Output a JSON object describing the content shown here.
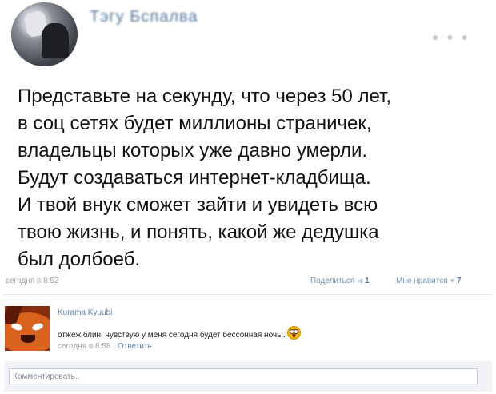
{
  "post": {
    "author": "Тэгу Бспалва",
    "more_icon": "more-horizontal-icon",
    "text_lines": [
      "Представьте на секунду, что через 50 лет,",
      "в соц сетях будет миллионы страничек,",
      "владельцы которых уже давно умерли.",
      "Будут создаваться интернет-кладбища.",
      "И твой внук сможет зайти и увидеть всю",
      "твою жизнь, и понять, какой же дедушка",
      "был долбоеб."
    ],
    "time": "сегодня в 8:52",
    "share_label": "Поделиться",
    "share_icon": "megaphone-icon",
    "share_count": "1",
    "like_label": "Мне нравится",
    "like_icon": "heart-icon",
    "like_count": "7"
  },
  "comment": {
    "author": "Kurama Kyuubi",
    "text": "отжеж блин, чувствую у меня сегодня будет бессонная ночь..",
    "emoji": "scared-face-emoji",
    "time": "сегодня в 8:58",
    "separator": "|",
    "reply_label": "Ответить"
  },
  "composer": {
    "placeholder": "Комментировать.."
  },
  "colors": {
    "link": "#5b7fa6",
    "muted": "#9ba3ac",
    "composer_bg": "#f0f2f5"
  }
}
